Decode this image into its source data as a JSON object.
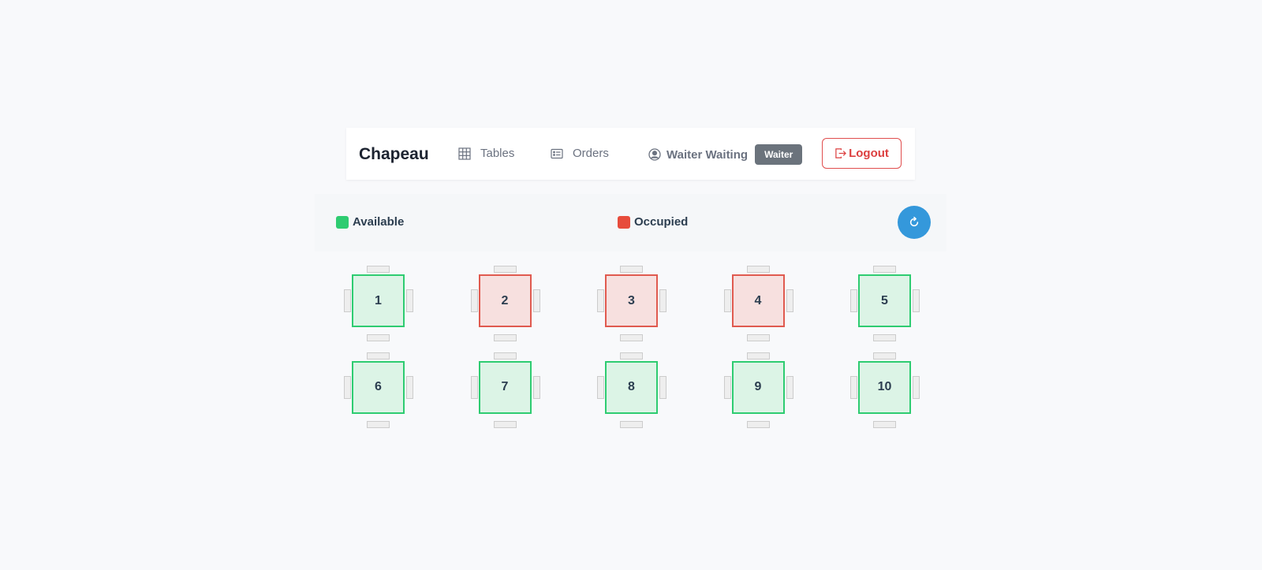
{
  "navbar": {
    "brand": "Chapeau",
    "links": [
      {
        "label": "Tables",
        "icon": "grid-icon"
      },
      {
        "label": "Orders",
        "icon": "list-card-icon"
      }
    ],
    "user": {
      "name": "Waiter Waiting",
      "role": "Waiter",
      "icon": "user-circle-icon"
    },
    "logout_label": "Logout"
  },
  "legend": {
    "available_label": "Available",
    "occupied_label": "Occupied",
    "colors": {
      "available": "#2ecc71",
      "occupied": "#e74c3c",
      "refresh": "#3498db"
    }
  },
  "tables": [
    {
      "number": "1",
      "status": "available"
    },
    {
      "number": "2",
      "status": "occupied"
    },
    {
      "number": "3",
      "status": "occupied"
    },
    {
      "number": "4",
      "status": "occupied"
    },
    {
      "number": "5",
      "status": "available"
    },
    {
      "number": "6",
      "status": "available"
    },
    {
      "number": "7",
      "status": "available"
    },
    {
      "number": "8",
      "status": "available"
    },
    {
      "number": "9",
      "status": "available"
    },
    {
      "number": "10",
      "status": "available"
    }
  ]
}
